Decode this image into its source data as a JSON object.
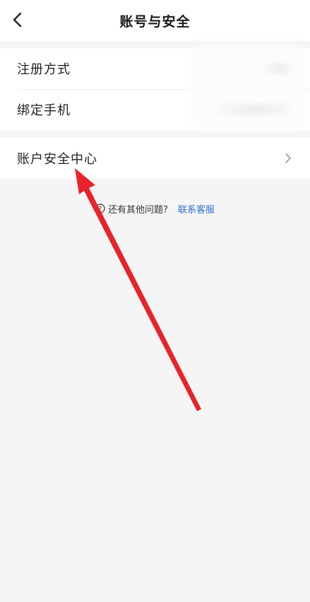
{
  "header": {
    "title": "账号与安全"
  },
  "settings": {
    "group1": [
      {
        "label": "注册方式"
      },
      {
        "label": "绑定手机"
      }
    ],
    "group2": [
      {
        "label": "账户安全中心"
      }
    ]
  },
  "help": {
    "text": "还有其他问题?",
    "link_label": "联系客服"
  },
  "icons": {
    "back": "chevron-left-icon",
    "row_arrow": "chevron-right-icon",
    "help": "help-circle-icon",
    "annotation": "red-arrow-icon"
  },
  "colors": {
    "link": "#2b6fd6",
    "annotation_arrow": "#e8232b",
    "background": "#f5f5f5"
  }
}
